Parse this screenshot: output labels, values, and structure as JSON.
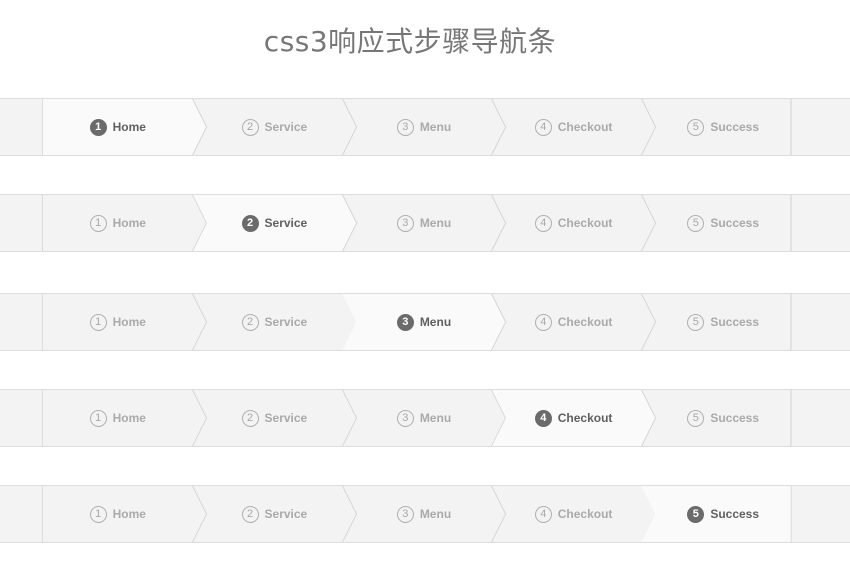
{
  "page": {
    "title": "css3响应式步骤导航条"
  },
  "colors": {
    "bar_background": "#f3f3f3",
    "active_background": "#fafafa",
    "border": "#dddddd",
    "active_circle": "#6b6b6b",
    "inactive_text": "#aaaaaa",
    "active_text": "#606060"
  },
  "steps": [
    {
      "number": "1",
      "label": "Home"
    },
    {
      "number": "2",
      "label": "Service"
    },
    {
      "number": "3",
      "label": "Menu"
    },
    {
      "number": "4",
      "label": "Checkout"
    },
    {
      "number": "5",
      "label": "Success"
    }
  ],
  "navbars": [
    {
      "active_step": 1
    },
    {
      "active_step": 2
    },
    {
      "active_step": 3
    },
    {
      "active_step": 4
    },
    {
      "active_step": 5
    }
  ]
}
